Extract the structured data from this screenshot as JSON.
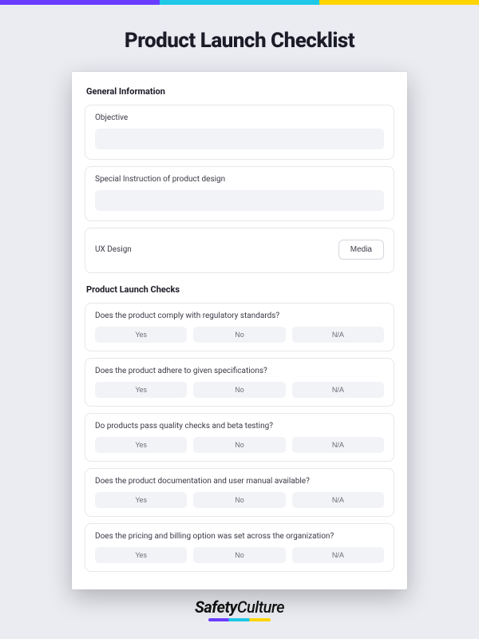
{
  "title": "Product Launch Checklist",
  "sections": {
    "general": {
      "heading": "General Information",
      "objective_label": "Objective",
      "special_label": "Special Instruction of product design",
      "ux_label": "UX Design",
      "media_button": "Media"
    },
    "checks": {
      "heading": "Product Launch Checks",
      "answers": {
        "yes": "Yes",
        "no": "No",
        "na": "N/A"
      },
      "questions": [
        "Does the product comply with regulatory standards?",
        "Does the product adhere to given specifications?",
        "Do products pass quality checks and beta testing?",
        "Does the product documentation and user manual available?",
        "Does the pricing and billing option was set across the organization?"
      ]
    }
  },
  "brand": {
    "part1": "Safety",
    "part2": "Culture"
  },
  "colors": {
    "purple": "#6a3cff",
    "cyan": "#1ec8e6",
    "yellow": "#ffd400",
    "page_bg": "#eaecf2",
    "field_bg": "#f2f3f6"
  }
}
